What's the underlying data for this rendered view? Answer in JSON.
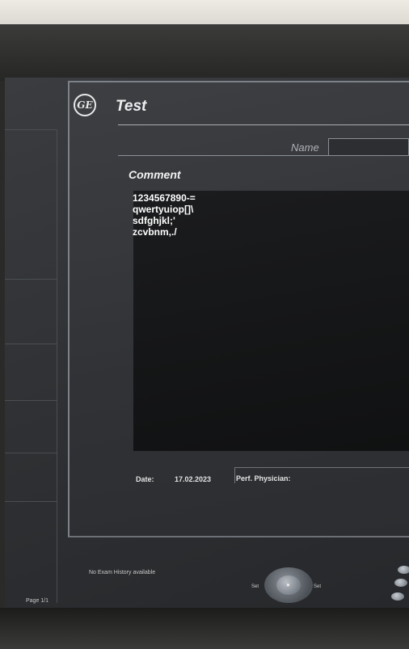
{
  "dialog": {
    "title": "Test",
    "name_label": "Name",
    "name_value": "",
    "comment_label": "Comment",
    "comment_lines": [
      "1234567890-=",
      "qwertyuiop[]\\",
      "sdfghjkl;'",
      "zcvbnm,./"
    ]
  },
  "footer": {
    "date_label": "Date:",
    "date_value": "17.02.2023",
    "physician_label": "Perf. Physician:"
  },
  "status": {
    "exam_history": "No Exam History available",
    "page": "Page 1/1"
  },
  "controls": {
    "set_left": "Set",
    "set_right": "Set"
  },
  "icons": {
    "logo": "ge-logo-icon",
    "trackball": "trackball-icon"
  },
  "colors": {
    "screen_bg": "#2f3134",
    "comment_bg": "#151617",
    "text": "#ffffff"
  }
}
